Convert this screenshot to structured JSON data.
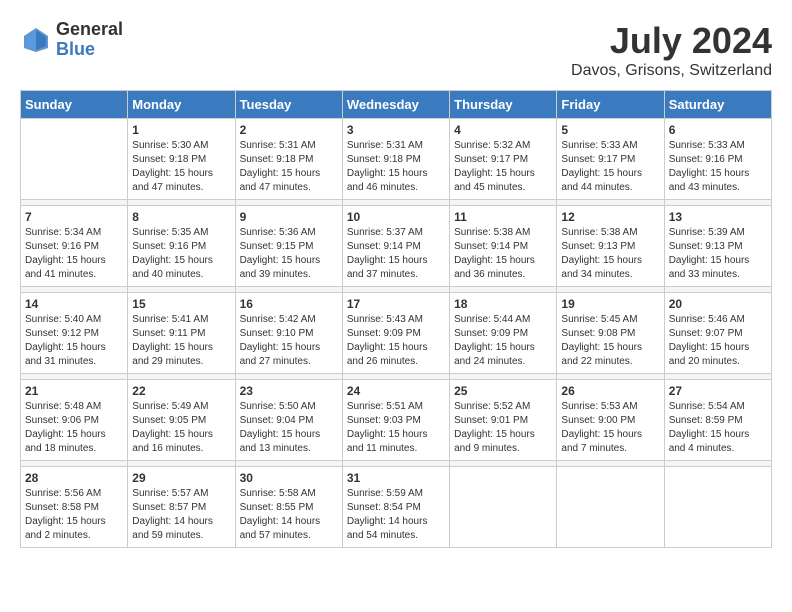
{
  "header": {
    "logo_general": "General",
    "logo_blue": "Blue",
    "month_year": "July 2024",
    "location": "Davos, Grisons, Switzerland"
  },
  "days_of_week": [
    "Sunday",
    "Monday",
    "Tuesday",
    "Wednesday",
    "Thursday",
    "Friday",
    "Saturday"
  ],
  "weeks": [
    [
      {
        "day": "",
        "info": ""
      },
      {
        "day": "1",
        "info": "Sunrise: 5:30 AM\nSunset: 9:18 PM\nDaylight: 15 hours\nand 47 minutes."
      },
      {
        "day": "2",
        "info": "Sunrise: 5:31 AM\nSunset: 9:18 PM\nDaylight: 15 hours\nand 47 minutes."
      },
      {
        "day": "3",
        "info": "Sunrise: 5:31 AM\nSunset: 9:18 PM\nDaylight: 15 hours\nand 46 minutes."
      },
      {
        "day": "4",
        "info": "Sunrise: 5:32 AM\nSunset: 9:17 PM\nDaylight: 15 hours\nand 45 minutes."
      },
      {
        "day": "5",
        "info": "Sunrise: 5:33 AM\nSunset: 9:17 PM\nDaylight: 15 hours\nand 44 minutes."
      },
      {
        "day": "6",
        "info": "Sunrise: 5:33 AM\nSunset: 9:16 PM\nDaylight: 15 hours\nand 43 minutes."
      }
    ],
    [
      {
        "day": "7",
        "info": "Sunrise: 5:34 AM\nSunset: 9:16 PM\nDaylight: 15 hours\nand 41 minutes."
      },
      {
        "day": "8",
        "info": "Sunrise: 5:35 AM\nSunset: 9:16 PM\nDaylight: 15 hours\nand 40 minutes."
      },
      {
        "day": "9",
        "info": "Sunrise: 5:36 AM\nSunset: 9:15 PM\nDaylight: 15 hours\nand 39 minutes."
      },
      {
        "day": "10",
        "info": "Sunrise: 5:37 AM\nSunset: 9:14 PM\nDaylight: 15 hours\nand 37 minutes."
      },
      {
        "day": "11",
        "info": "Sunrise: 5:38 AM\nSunset: 9:14 PM\nDaylight: 15 hours\nand 36 minutes."
      },
      {
        "day": "12",
        "info": "Sunrise: 5:38 AM\nSunset: 9:13 PM\nDaylight: 15 hours\nand 34 minutes."
      },
      {
        "day": "13",
        "info": "Sunrise: 5:39 AM\nSunset: 9:13 PM\nDaylight: 15 hours\nand 33 minutes."
      }
    ],
    [
      {
        "day": "14",
        "info": "Sunrise: 5:40 AM\nSunset: 9:12 PM\nDaylight: 15 hours\nand 31 minutes."
      },
      {
        "day": "15",
        "info": "Sunrise: 5:41 AM\nSunset: 9:11 PM\nDaylight: 15 hours\nand 29 minutes."
      },
      {
        "day": "16",
        "info": "Sunrise: 5:42 AM\nSunset: 9:10 PM\nDaylight: 15 hours\nand 27 minutes."
      },
      {
        "day": "17",
        "info": "Sunrise: 5:43 AM\nSunset: 9:09 PM\nDaylight: 15 hours\nand 26 minutes."
      },
      {
        "day": "18",
        "info": "Sunrise: 5:44 AM\nSunset: 9:09 PM\nDaylight: 15 hours\nand 24 minutes."
      },
      {
        "day": "19",
        "info": "Sunrise: 5:45 AM\nSunset: 9:08 PM\nDaylight: 15 hours\nand 22 minutes."
      },
      {
        "day": "20",
        "info": "Sunrise: 5:46 AM\nSunset: 9:07 PM\nDaylight: 15 hours\nand 20 minutes."
      }
    ],
    [
      {
        "day": "21",
        "info": "Sunrise: 5:48 AM\nSunset: 9:06 PM\nDaylight: 15 hours\nand 18 minutes."
      },
      {
        "day": "22",
        "info": "Sunrise: 5:49 AM\nSunset: 9:05 PM\nDaylight: 15 hours\nand 16 minutes."
      },
      {
        "day": "23",
        "info": "Sunrise: 5:50 AM\nSunset: 9:04 PM\nDaylight: 15 hours\nand 13 minutes."
      },
      {
        "day": "24",
        "info": "Sunrise: 5:51 AM\nSunset: 9:03 PM\nDaylight: 15 hours\nand 11 minutes."
      },
      {
        "day": "25",
        "info": "Sunrise: 5:52 AM\nSunset: 9:01 PM\nDaylight: 15 hours\nand 9 minutes."
      },
      {
        "day": "26",
        "info": "Sunrise: 5:53 AM\nSunset: 9:00 PM\nDaylight: 15 hours\nand 7 minutes."
      },
      {
        "day": "27",
        "info": "Sunrise: 5:54 AM\nSunset: 8:59 PM\nDaylight: 15 hours\nand 4 minutes."
      }
    ],
    [
      {
        "day": "28",
        "info": "Sunrise: 5:56 AM\nSunset: 8:58 PM\nDaylight: 15 hours\nand 2 minutes."
      },
      {
        "day": "29",
        "info": "Sunrise: 5:57 AM\nSunset: 8:57 PM\nDaylight: 14 hours\nand 59 minutes."
      },
      {
        "day": "30",
        "info": "Sunrise: 5:58 AM\nSunset: 8:55 PM\nDaylight: 14 hours\nand 57 minutes."
      },
      {
        "day": "31",
        "info": "Sunrise: 5:59 AM\nSunset: 8:54 PM\nDaylight: 14 hours\nand 54 minutes."
      },
      {
        "day": "",
        "info": ""
      },
      {
        "day": "",
        "info": ""
      },
      {
        "day": "",
        "info": ""
      }
    ]
  ]
}
